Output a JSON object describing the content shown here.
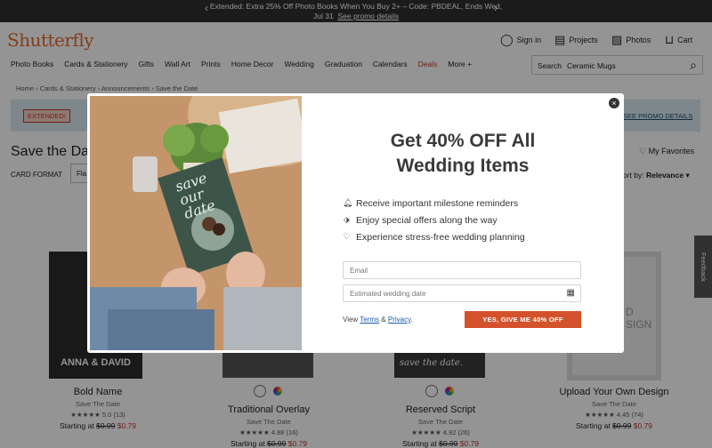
{
  "promo": {
    "line1": "Extended: Extra 25% Off Photo Books When You Buy 2+ – Code: PBDEAL, Ends Wed,",
    "line2": "Jul 31",
    "link": "See promo details",
    "prev_icon": "chevron-left-icon",
    "next_icon": "chevron-right-icon"
  },
  "header": {
    "logo": "Shutterfly",
    "signin": "Sign in",
    "projects": "Projects",
    "photos": "Photos",
    "cart": "Cart",
    "nav": [
      "Photo Books",
      "Cards & Stationery",
      "Gifts",
      "Wall Art",
      "Prints",
      "Home Decor",
      "Wedding",
      "Graduation",
      "Calendars",
      "Deals",
      "More"
    ],
    "search_label": "Search",
    "search_value": "Ceramic Mugs"
  },
  "breadcrumbs": [
    "Home",
    "Cards & Stationery",
    "Announcements",
    "Save the Date"
  ],
  "banner": {
    "badge": "EXTENDED!",
    "link": "SEE PROMO DETAILS"
  },
  "page": {
    "title": "Save the Da",
    "card_format_label": "CARD FORMAT",
    "card_format_value": "Fla",
    "favorites": "My Favorites",
    "sort_label": "ort by:",
    "sort_value": "Relevance",
    "feedback": "Feedback"
  },
  "products": [
    {
      "name": "Bold Name",
      "type": "Save The Date",
      "stars": "★★★★★",
      "rating": "5.0",
      "count": "(13)",
      "price_label": "Starting at",
      "old": "$0.99",
      "new": "$0.79",
      "thumb_text": "ANNA & DAVID"
    },
    {
      "name": "Traditional Overlay",
      "type": "Save The Date",
      "stars": "★★★★★",
      "rating": "4.88",
      "count": "(16)",
      "price_label": "Starting at",
      "old": "$0.99",
      "new": "$0.79"
    },
    {
      "name": "Reserved Script",
      "type": "Save The Date",
      "stars": "★★★★★",
      "rating": "4.92",
      "count": "(26)",
      "price_label": "Starting at",
      "old": "$0.99",
      "new": "$0.79",
      "thumb_text": "save the date."
    },
    {
      "name": "Upload Your Own Design",
      "type": "Save The Date",
      "stars": "★★★★★",
      "rating": "4.45",
      "count": "(74)",
      "price_label": "Starting at",
      "old": "$0.99",
      "new": "$0.79",
      "thumb_text": "D SIGN"
    }
  ],
  "modal": {
    "headline": "Get 40% OFF All Wedding Items",
    "benefits": [
      {
        "icon": "bell-icon",
        "text": "Receive important milestone reminders"
      },
      {
        "icon": "tag-icon",
        "text": "Enjoy special offers along the way"
      },
      {
        "icon": "heart-icon",
        "text": "Experience stress-free wedding planning"
      }
    ],
    "email_placeholder": "Email",
    "date_placeholder": "Estimated wedding date",
    "terms_view": "View",
    "terms_link": "Terms",
    "terms_amp": "&",
    "privacy_link": "Privacy",
    "cta": "YES, GIVE ME 40% OFF",
    "card_text": "save our date"
  }
}
